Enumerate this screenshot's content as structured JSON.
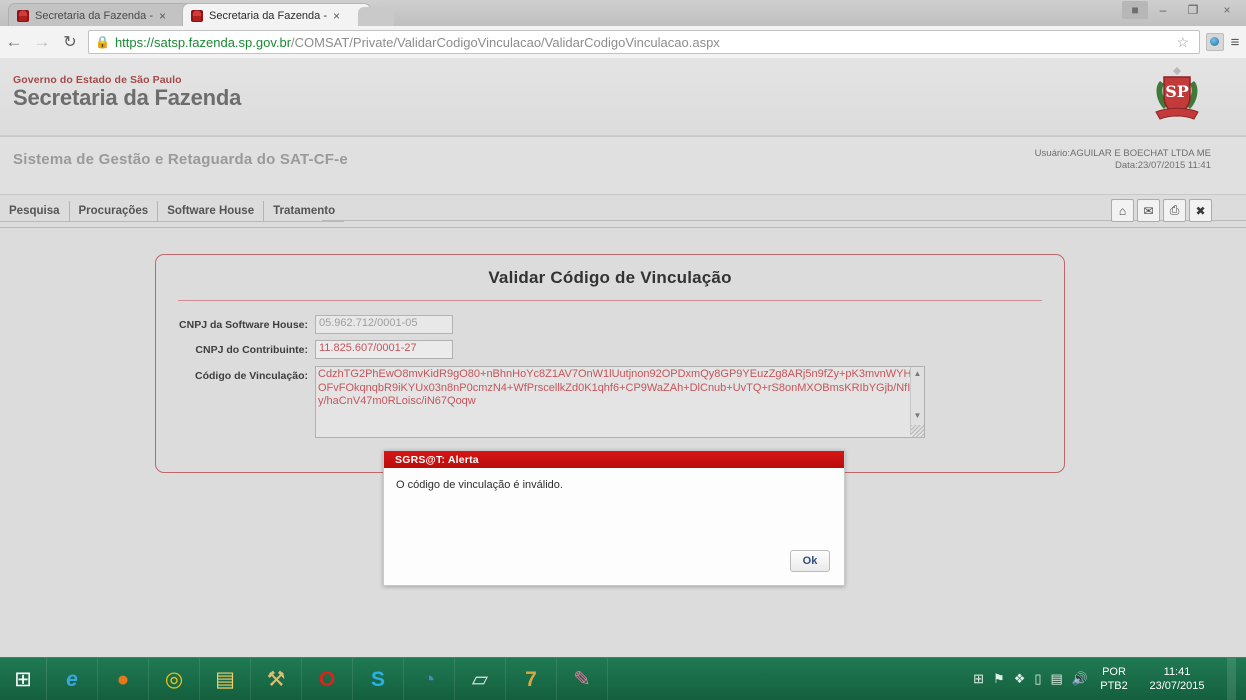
{
  "browser": {
    "tabs": [
      {
        "title": "Secretaria da Fazenda - G",
        "close": "×",
        "favicon": "sp-crest-favicon"
      },
      {
        "title": "Secretaria da Fazenda - G",
        "close": "×",
        "favicon": "sp-crest-favicon"
      }
    ],
    "window_controls": {
      "user": "■",
      "minimize": "–",
      "restore": "❐",
      "close": "×"
    },
    "nav": {
      "back": "←",
      "forward": "→",
      "reload": "↻"
    },
    "omnibox": {
      "lock": "🔒",
      "scheme_host": "https://satsp.fazenda.sp.gov.br",
      "path": "/COMSAT/Private/ValidarCodigoVinculacao/ValidarCodigoVinculacao.aspx",
      "bookmark": "☆",
      "menu": "≡"
    }
  },
  "site_header": {
    "gov_line": "Governo do Estado de São Paulo",
    "org_line": "Secretaria da Fazenda",
    "crest_alt": "sp-coat-of-arms"
  },
  "system_bar": {
    "title": "Sistema de Gestão e Retaguarda do SAT-CF-e",
    "user_line": "Usuário:AGUILAR E BOECHAT LTDA ME",
    "date_line": "Data:23/07/2015 11:41"
  },
  "menu": {
    "items": [
      {
        "label": "Pesquisa"
      },
      {
        "label": "Procurações"
      },
      {
        "label": "Software House"
      },
      {
        "label": "Tratamento"
      }
    ],
    "tools": [
      {
        "name": "home-icon",
        "glyph": "⌂"
      },
      {
        "name": "mail-icon",
        "glyph": "✉"
      },
      {
        "name": "print-icon",
        "glyph": "⎙"
      },
      {
        "name": "close-icon",
        "glyph": "✖"
      }
    ]
  },
  "panel": {
    "title": "Validar Código de Vinculação",
    "fields": {
      "software_house": {
        "label": "CNPJ da Software House:",
        "value": "05.962.712/0001-05"
      },
      "contribuinte": {
        "label": "CNPJ do Contribuinte:",
        "value": "11.825.607/0001-27"
      },
      "codigo": {
        "label": "Código de Vinculação:",
        "value": "CdzhTG2PhEwO8mvKidR9gO80+nBhnHoYc8Z1AV7OnW1lUutjnon92OPDxmQy8GP9YEuzZg8ARj5n9fZy+pK3mvnWYHCOFvFOkqnqbR9iKYUx03n8nP0cmzN4+WfPrscellkZd0K1qhf6+CP9WaZAh+DlCnub+UvTQ+rS8onMXOBmsKRIbYGjb/NfIfQy/haCnV47m0RLoisc/iN67Qoqw",
        "scroll_up": "▲",
        "scroll_down": "▼"
      }
    }
  },
  "dialog": {
    "title": "SGRS@T: Alerta",
    "message": "O código de vinculação é inválido.",
    "ok_label": "Ok"
  },
  "taskbar": {
    "start": {
      "name": "start-button",
      "glyph": "⊞"
    },
    "items": [
      {
        "name": "internet-explorer-icon",
        "glyph": "e",
        "color": "#2ea3dd"
      },
      {
        "name": "firefox-icon",
        "glyph": "●",
        "color": "#e8761b"
      },
      {
        "name": "chrome-icon",
        "glyph": "◎",
        "color": "#f0c419"
      },
      {
        "name": "file-explorer-icon",
        "glyph": "▤",
        "color": "#f0cf6b"
      },
      {
        "name": "tools-icon",
        "glyph": "⚒",
        "color": "#d9c07a"
      },
      {
        "name": "opera-icon",
        "glyph": "O",
        "color": "#d9231f"
      },
      {
        "name": "skype-icon",
        "glyph": "S",
        "color": "#29b0e8"
      },
      {
        "name": "thunderbird-icon",
        "glyph": "◔",
        "color": "#2f6ea8"
      },
      {
        "name": "notepad-icon",
        "glyph": "▱",
        "color": "#cfd8e3"
      },
      {
        "name": "sevenzip-icon",
        "glyph": "7",
        "color": "#d6a93c"
      },
      {
        "name": "paint-icon",
        "glyph": "✎",
        "color": "#e07aa0"
      }
    ],
    "tray": {
      "icons": [
        {
          "name": "action-center-icon",
          "glyph": "⊞"
        },
        {
          "name": "flag-icon",
          "glyph": "⚑"
        },
        {
          "name": "antivirus-icon",
          "glyph": "❖"
        },
        {
          "name": "battery-icon",
          "glyph": "▯"
        },
        {
          "name": "network-icon",
          "glyph": "▤"
        },
        {
          "name": "volume-icon",
          "glyph": "🔊"
        }
      ],
      "lang_top": "POR",
      "lang_bottom": "PTB2",
      "time": "11:41",
      "date": "23/07/2015"
    }
  },
  "colors": {
    "brand_red": "#c0666b",
    "dialog_red": "#cc0f0f",
    "gov_red": "#a34a4a",
    "taskbar_green": "#1a6e49"
  }
}
